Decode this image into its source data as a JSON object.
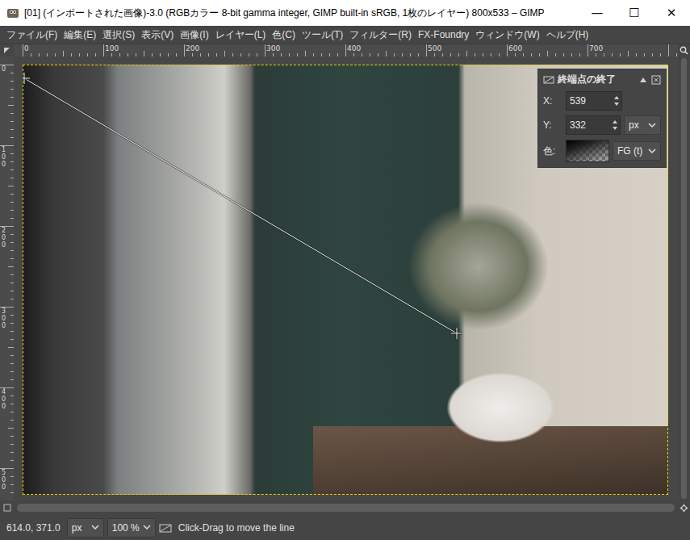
{
  "window": {
    "title": "[01] (インポートされた画像)-3.0 (RGBカラー 8-bit gamma integer, GIMP built-in sRGB, 1枚のレイヤー) 800x533 – GIMP",
    "controls": [
      "—",
      "☐",
      "✕"
    ]
  },
  "menu": [
    "ファイル(F)",
    "編集(E)",
    "選択(S)",
    "表示(V)",
    "画像(I)",
    "レイヤー(L)",
    "色(C)",
    "ツール(T)",
    "フィルター(R)",
    "FX-Foundry",
    "ウィンドウ(W)",
    "ヘルプ(H)"
  ],
  "rulers": {
    "horizontal": [
      "0",
      "100",
      "200",
      "300",
      "400",
      "500",
      "600",
      "700"
    ],
    "vertical": [
      "0",
      "100",
      "200",
      "300",
      "400",
      "500"
    ]
  },
  "tool_panel": {
    "title": "終端点の終了",
    "fields": [
      {
        "label": "X:",
        "value": "539",
        "unit": ""
      },
      {
        "label": "Y:",
        "value": "332",
        "unit": "px"
      }
    ],
    "color_label": "色:",
    "color_source": "FG (t)"
  },
  "status_bar": {
    "pointer": "614.0, 371.0",
    "unit": "px",
    "zoom": "100 %",
    "message": "Click-Drag to move the line"
  }
}
